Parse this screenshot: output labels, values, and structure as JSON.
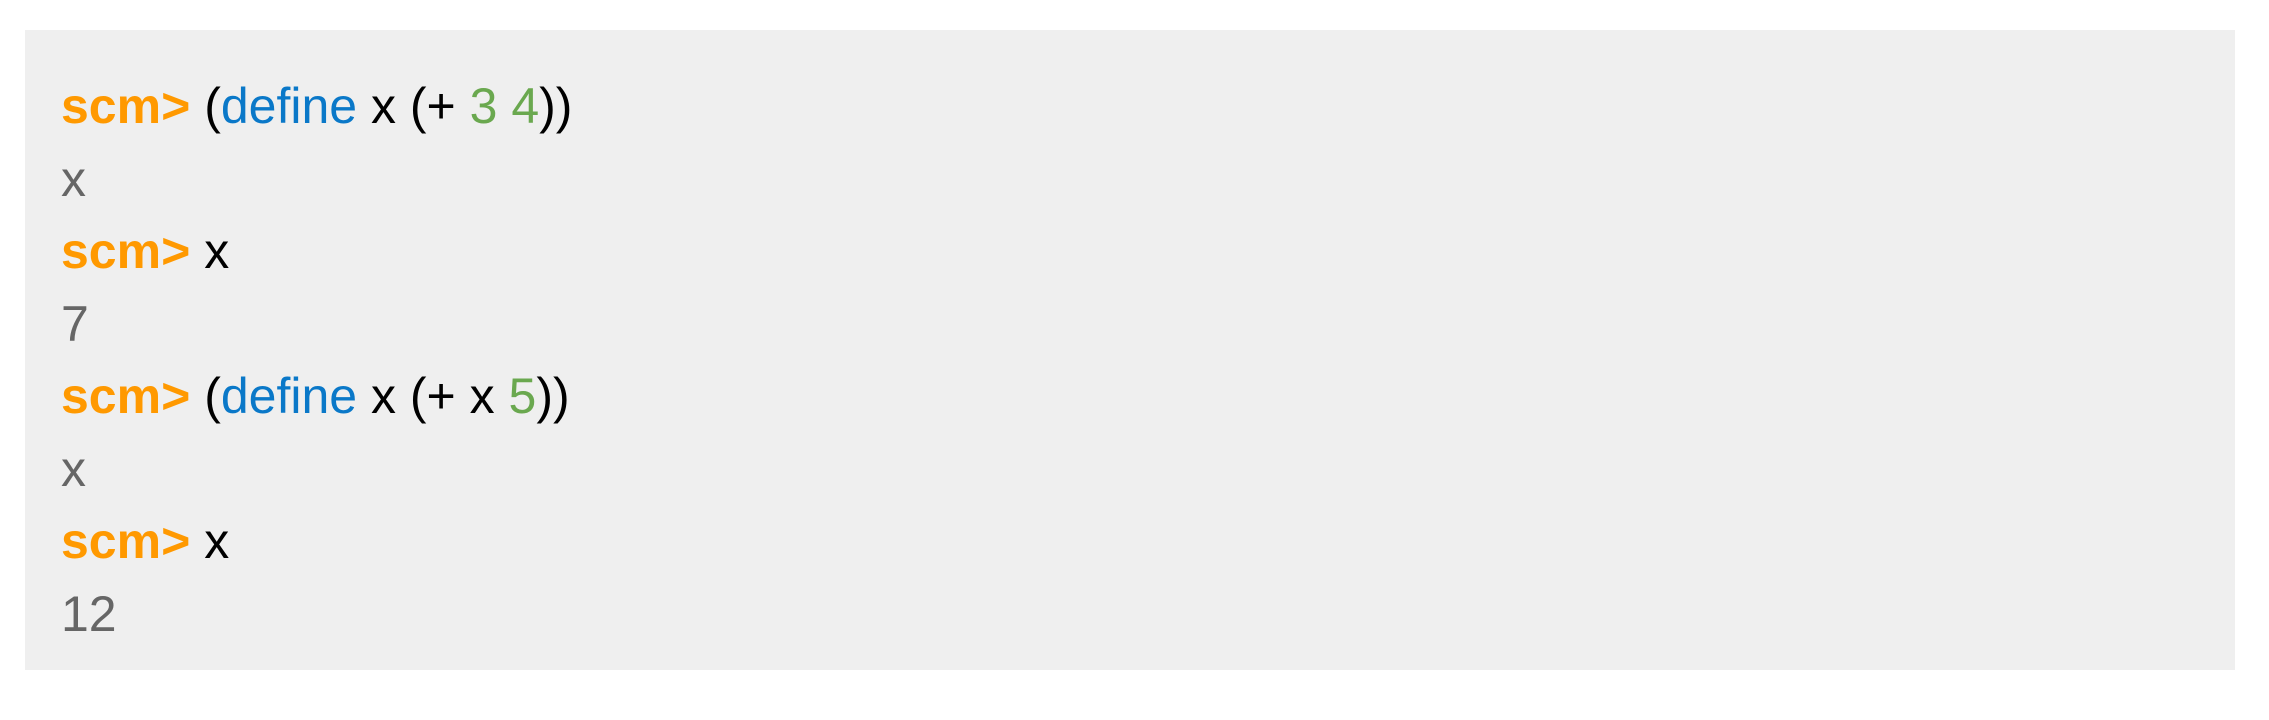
{
  "colors": {
    "prompt": "#ff9900",
    "keyword": "#0a78c8",
    "number": "#6aa84f",
    "output": "#666666",
    "panel_background": "#efefef"
  },
  "repl": {
    "lines": [
      {
        "type": "input",
        "prompt": "scm>",
        "tokens": [
          {
            "kind": "paren",
            "text": "("
          },
          {
            "kind": "keyword",
            "text": "define"
          },
          {
            "kind": "plain",
            "text": " x "
          },
          {
            "kind": "paren",
            "text": "(+ "
          },
          {
            "kind": "number",
            "text": "3"
          },
          {
            "kind": "plain",
            "text": " "
          },
          {
            "kind": "number",
            "text": "4"
          },
          {
            "kind": "paren",
            "text": "))"
          }
        ]
      },
      {
        "type": "output",
        "text": "x"
      },
      {
        "type": "input",
        "prompt": "scm>",
        "tokens": [
          {
            "kind": "plain",
            "text": "x"
          }
        ]
      },
      {
        "type": "output",
        "text": "7"
      },
      {
        "type": "input",
        "prompt": "scm>",
        "tokens": [
          {
            "kind": "paren",
            "text": "("
          },
          {
            "kind": "keyword",
            "text": "define"
          },
          {
            "kind": "plain",
            "text": " x "
          },
          {
            "kind": "paren",
            "text": "(+ x "
          },
          {
            "kind": "number",
            "text": "5"
          },
          {
            "kind": "paren",
            "text": "))"
          }
        ]
      },
      {
        "type": "output",
        "text": "x"
      },
      {
        "type": "input",
        "prompt": "scm>",
        "tokens": [
          {
            "kind": "plain",
            "text": "x"
          }
        ]
      },
      {
        "type": "output",
        "text": "12"
      }
    ]
  }
}
